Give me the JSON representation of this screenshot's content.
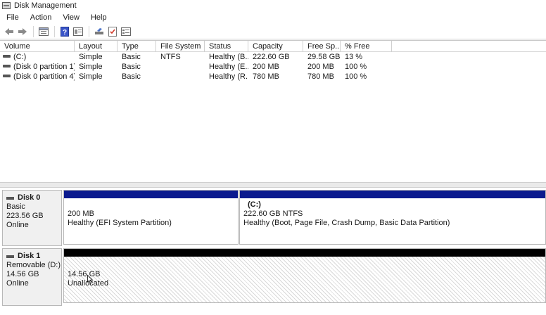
{
  "window": {
    "title": "Disk Management"
  },
  "menu": [
    "File",
    "Action",
    "View",
    "Help"
  ],
  "toolbar": {
    "icons": [
      "back-arrow-icon",
      "forward-arrow-icon",
      "disk-list-icon",
      "help-icon",
      "properties-icon",
      "connect-icon",
      "checklist-icon",
      "view-icon"
    ]
  },
  "volume_table": {
    "headers": [
      "Volume",
      "Layout",
      "Type",
      "File System",
      "Status",
      "Capacity",
      "Free Sp...",
      "% Free"
    ],
    "rows": [
      [
        "(C:)",
        "Simple",
        "Basic",
        "NTFS",
        "Healthy (B...",
        "222.60 GB",
        "29.58 GB",
        "13 %"
      ],
      [
        "(Disk 0 partition 1)",
        "Simple",
        "Basic",
        "",
        "Healthy (E...",
        "200 MB",
        "200 MB",
        "100 %"
      ],
      [
        "(Disk 0 partition 4)",
        "Simple",
        "Basic",
        "",
        "Healthy (R...",
        "780 MB",
        "780 MB",
        "100 %"
      ]
    ]
  },
  "disks": [
    {
      "name": "Disk 0",
      "type": "Basic",
      "size": "223.56 GB",
      "status": "Online",
      "partitions": [
        {
          "label": "",
          "line1": "200 MB",
          "line2": "Healthy (EFI System Partition)",
          "bar_color": "#0b1a8e"
        },
        {
          "label": "(C:)",
          "line1": "222.60 GB NTFS",
          "line2": "Healthy (Boot, Page File, Crash Dump, Basic Data Partition)",
          "bar_color": "#0b1a8e"
        }
      ]
    },
    {
      "name": "Disk 1",
      "type": "Removable (D:)",
      "size": "14.56 GB",
      "status": "Online",
      "partitions": [
        {
          "label": "",
          "line1": "14.56 GB",
          "line2": "Unallocated",
          "bar_color": "#000000"
        }
      ]
    }
  ]
}
